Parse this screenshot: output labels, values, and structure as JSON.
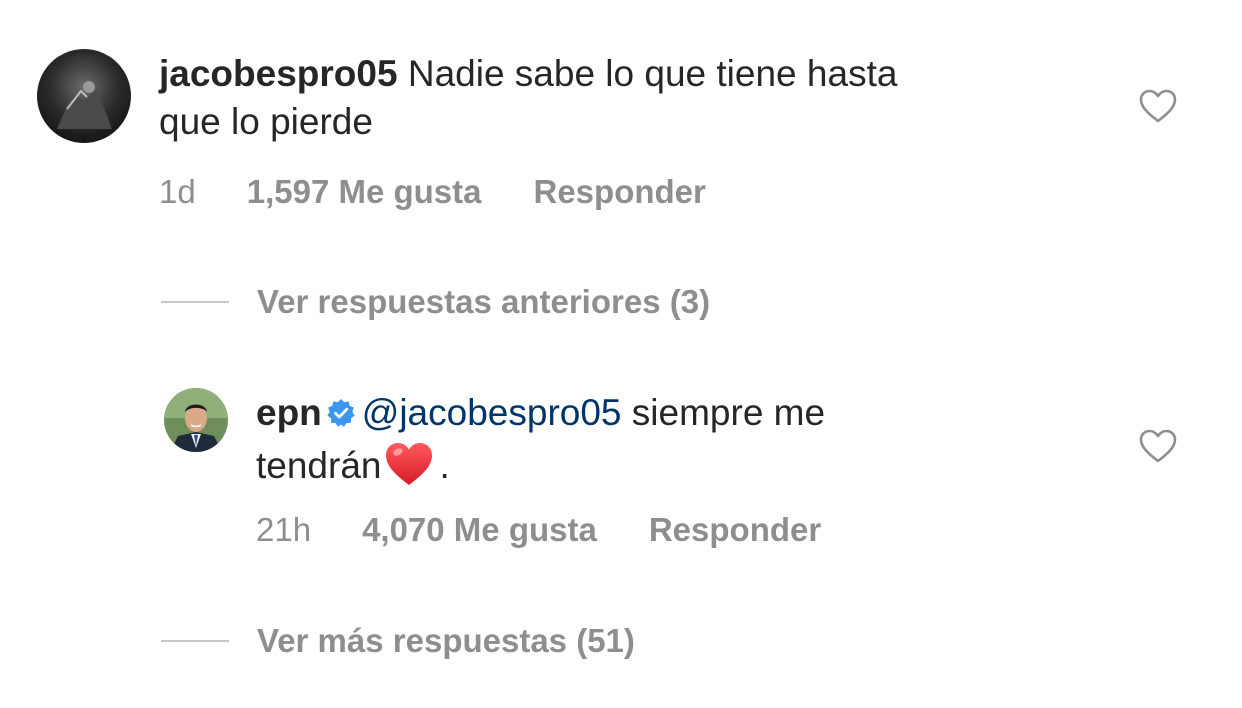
{
  "comment": {
    "username": "jacobespro05",
    "text_line1": "Nadie sabe lo que tiene hasta",
    "text_line2": "que lo pierde",
    "time": "1d",
    "likes": "1,597 Me gusta",
    "reply_label": "Responder"
  },
  "view_previous_replies": "Ver respuestas anteriores (3)",
  "reply": {
    "username": "epn",
    "mention": "@jacobespro05",
    "text_line1_rest": "siempre me",
    "text_line2": "tendrán",
    "text_line2_end": ".",
    "time": "21h",
    "likes": "4,070 Me gusta",
    "reply_label": "Responder"
  },
  "view_more_replies": "Ver más respuestas (51)",
  "icons": {
    "like": "heart-outline-icon",
    "verified": "verified-badge-icon",
    "emoji": "red-heart-emoji"
  },
  "colors": {
    "text": "#262626",
    "muted": "#8e8e8e",
    "mention": "#003569",
    "verified": "#3897f0",
    "heart": "#e0202e"
  }
}
